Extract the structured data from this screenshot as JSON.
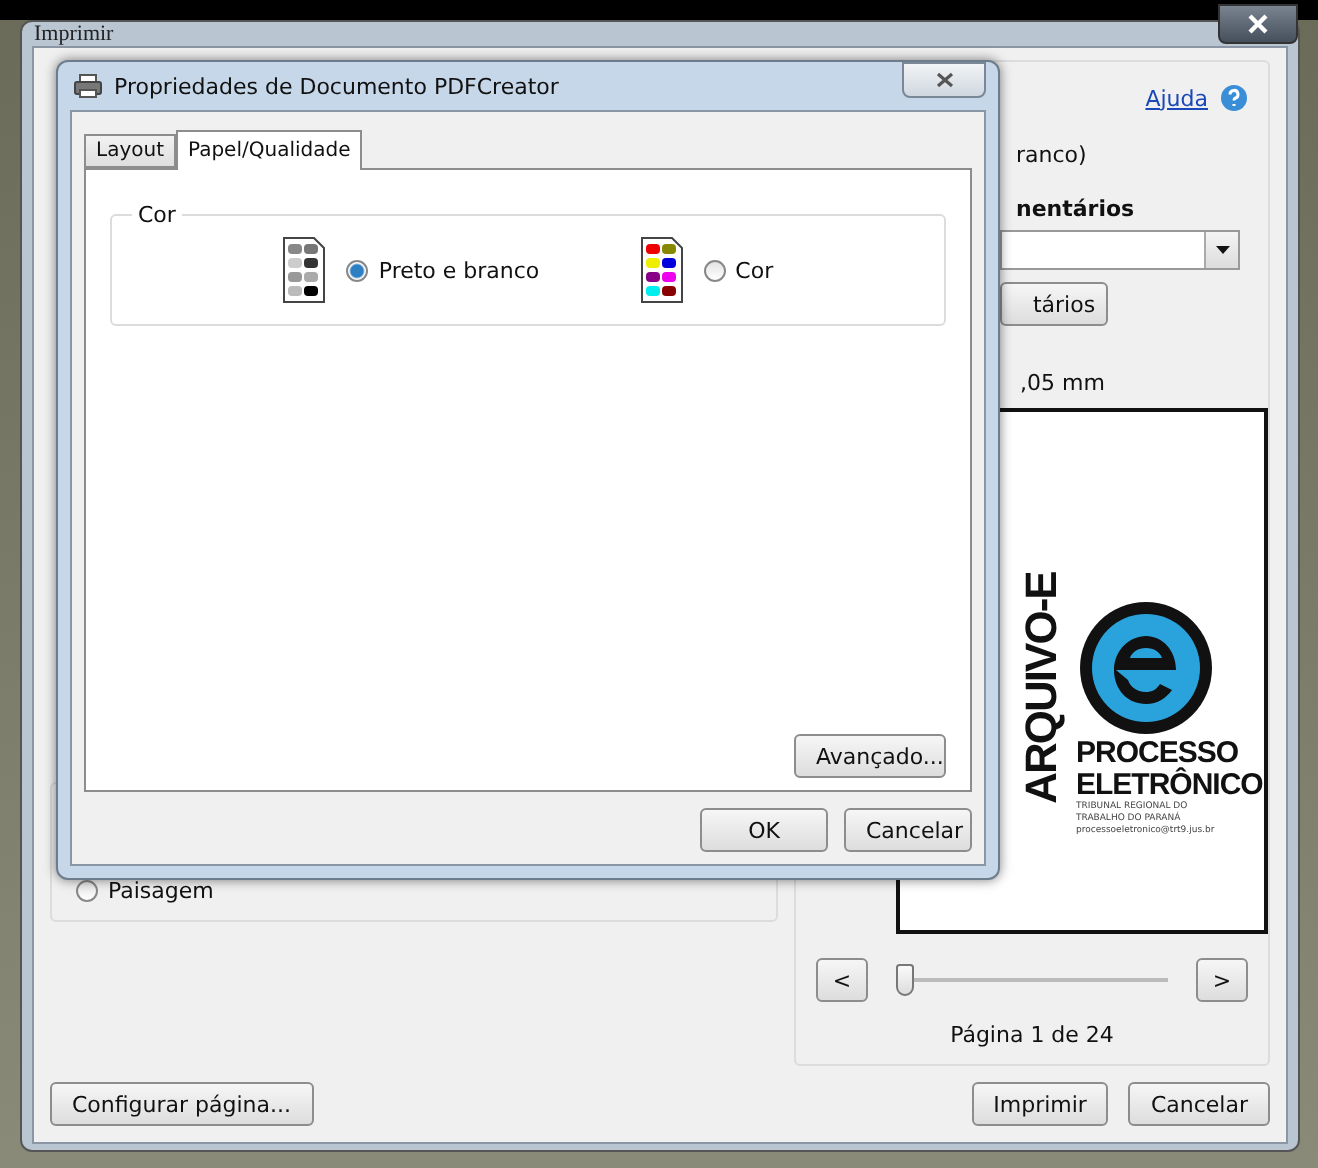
{
  "print_window": {
    "title": "Imprimir",
    "help_link": "Ajuda",
    "right_panel": {
      "color_text": "ranco)",
      "comments_label": "nentários",
      "comments_button": "tários",
      "size_text": ",05 mm",
      "preview": {
        "vertical_title": "ARQUIVO-E",
        "title_line_1": "PROCESSO",
        "title_line_2": "ELETRÔNICO",
        "subtitle_lines": [
          "TRIBUNAL REGIONAL DO",
          "TRABALHO DO PARANÁ",
          "processoeletronico@trt9.jus.br"
        ]
      },
      "prev_button": "<",
      "next_button": ">",
      "page_slider": {
        "level": 0
      },
      "page_label": "Página 1 de 24"
    },
    "orientation": [
      {
        "label": "Paisagem",
        "selected": false
      }
    ],
    "buttons": {
      "setup": "Configurar página...",
      "print": "Imprimir",
      "cancel": "Cancelar"
    }
  },
  "properties_dialog": {
    "title": "Propriedades de Documento PDFCreator",
    "tabs": [
      {
        "label": "Layout",
        "selected": false
      },
      {
        "label": "Papel/Qualidade",
        "selected": true
      }
    ],
    "color_group": {
      "title": "Cor",
      "options": [
        {
          "kind": "mono",
          "label": "Preto e branco",
          "selected": true
        },
        {
          "kind": "color",
          "label": "Cor",
          "selected": false
        }
      ]
    },
    "advanced_button": "Avançado...",
    "ok_button": "OK",
    "cancel_button": "Cancelar"
  }
}
